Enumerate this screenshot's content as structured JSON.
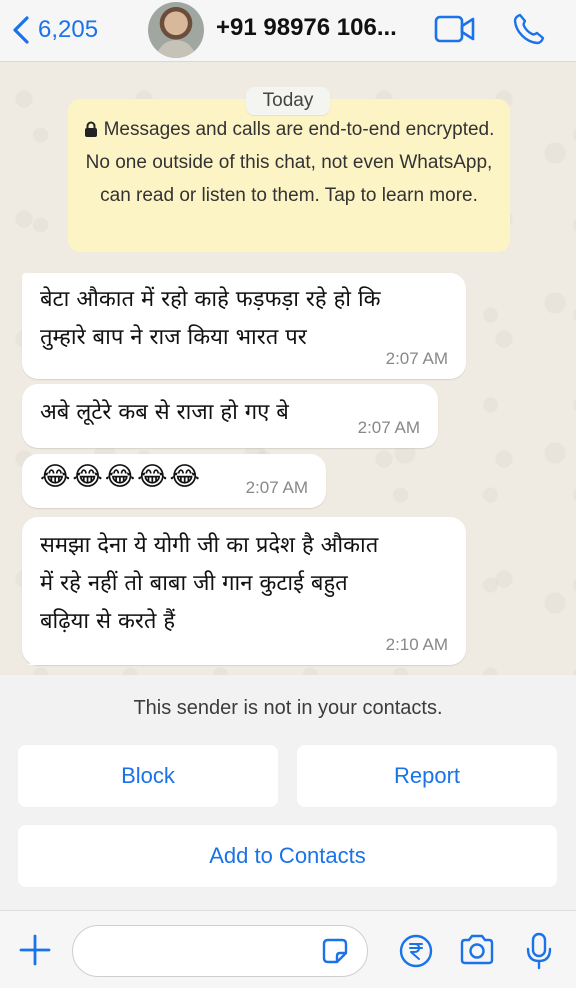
{
  "header": {
    "back_count": "6,205",
    "contact_title": "+91 98976 106...",
    "icons": [
      "chevron-left-icon",
      "avatar",
      "video-call-icon",
      "phone-icon"
    ],
    "accent_color": "#1a73e8"
  },
  "chat": {
    "date_label": "Today",
    "encryption_notice": "Messages and calls are end-to-end encrypted. No one outside of this chat, not even WhatsApp, can read or listen to them. Tap to learn more.",
    "messages": [
      {
        "text": "बेटा औकात में रहो काहे फड़फड़ा रहे हो कि\nतुम्हारे बाप ने राज किया भारत पर",
        "time": "2:07 AM"
      },
      {
        "text": "अबे लूटेरे कब से राजा हो गए बे",
        "time": "2:07 AM"
      },
      {
        "text": "😂😂😂😂😂",
        "time": "2:07 AM"
      },
      {
        "text": "समझा देना ये योगी जी का प्रदेश है औकात\nमें रहे नहीं तो बाबा जी गान कुटाई बहुत\nबढ़िया से करते हैं",
        "time": "2:10 AM"
      }
    ]
  },
  "unknown_sender": {
    "notice": "This sender is not in your contacts.",
    "block_label": "Block",
    "report_label": "Report",
    "add_label": "Add to Contacts"
  },
  "input_bar": {
    "value": "",
    "icons": [
      "plus-icon",
      "sticker-icon",
      "rupee-icon",
      "camera-icon",
      "mic-icon"
    ]
  }
}
